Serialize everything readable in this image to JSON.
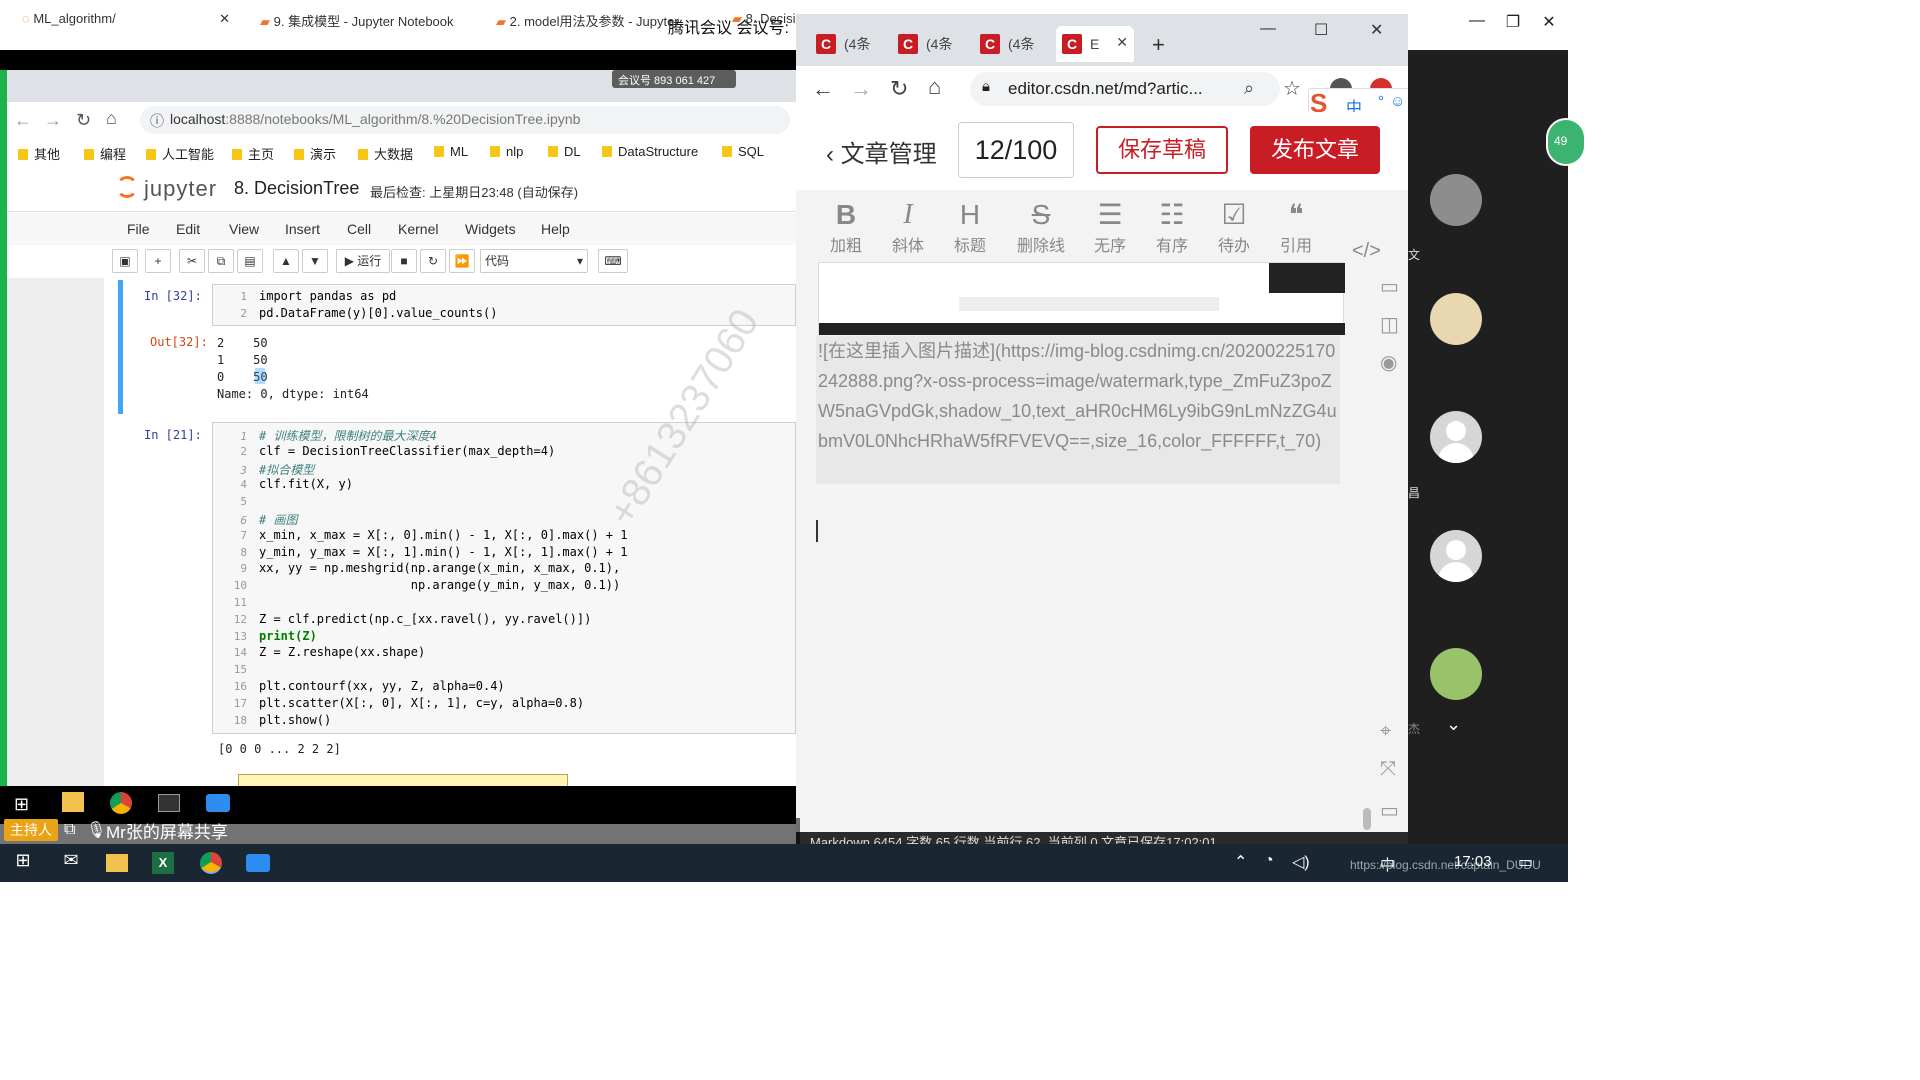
{
  "meeting": {
    "title": "腾讯会议 会议号:",
    "tag": "会议号 893 061 427",
    "participants_count": "49",
    "side_labels": [
      "文",
      "昌",
      "杰"
    ]
  },
  "jupyter_browser": {
    "tabs": [
      "ML_algorithm/",
      "9. 集成模型 - Jupyter Notebook",
      "2. model用法及参数 - Jupyter",
      "8. Decisi"
    ],
    "url_host": "localhost",
    "url_rest": ":8888/notebooks/ML_algorithm/8.%20DecisionTree.ipynb",
    "bookmarks": [
      "其他",
      "编程",
      "人工智能",
      "主页",
      "演示",
      "大数据",
      "ML",
      "nlp",
      "DL",
      "DataStructure",
      "SQL"
    ],
    "logo": "jupyter",
    "notebook_name": "8. DecisionTree",
    "checkpoint": "最后检查: 上星期日23:48  (自动保存)",
    "menus": [
      "File",
      "Edit",
      "View",
      "Insert",
      "Cell",
      "Kernel",
      "Widgets",
      "Help"
    ],
    "run_label": "运行",
    "cell_type": "代码"
  },
  "cells": {
    "c1_prompt": "In  [32]:",
    "c1_l1": "import pandas as pd",
    "c1_l2": "pd.DataFrame(y)[0].value_counts()",
    "o1_prompt": "Out[32]:",
    "o1_lines": [
      "2    50",
      "1    50",
      "0    50",
      "Name: 0, dtype: int64"
    ],
    "c2_prompt": "In  [21]:",
    "c2_lines": [
      "# 训练模型，限制树的最大深度4",
      "clf = DecisionTreeClassifier(max_depth=4)",
      "#拟合模型",
      "clf.fit(X, y)",
      "",
      "# 画图",
      "x_min, x_max = X[:, 0].min() - 1, X[:, 0].max() + 1",
      "y_min, y_max = X[:, 1].min() - 1, X[:, 1].max() + 1",
      "xx, yy = np.meshgrid(np.arange(x_min, x_max, 0.1),",
      "                     np.arange(y_min, y_max, 0.1))",
      "",
      "Z = clf.predict(np.c_[xx.ravel(), yy.ravel()])",
      "print(Z)",
      "Z = Z.reshape(xx.shape)",
      "",
      "plt.contourf(xx, yy, Z, alpha=0.4)",
      "plt.scatter(X[:, 0], X[:, 1], c=y, alpha=0.8)",
      "plt.show()"
    ],
    "o2_text": "[0 0 0 ... 2 2 2]",
    "watermark": "+8613237060"
  },
  "csdn": {
    "tabs": [
      "(4条",
      "(4条",
      "(4条",
      "E"
    ],
    "url": "editor.csdn.net/md?artic...",
    "back_label": "文章管理",
    "title_count": "12/100",
    "save_draft": "保存草稿",
    "publish": "发布文章",
    "format_tools": [
      {
        "glyph": "B",
        "label": "加粗"
      },
      {
        "glyph": "I",
        "label": "斜体"
      },
      {
        "glyph": "H",
        "label": "标题"
      },
      {
        "glyph": "S",
        "label": "删除线"
      },
      {
        "glyph": "☰",
        "label": "无序"
      },
      {
        "glyph": "☷",
        "label": "有序"
      },
      {
        "glyph": "☑",
        "label": "待办"
      },
      {
        "glyph": "❝",
        "label": "引用"
      }
    ],
    "markdown_text": "![在这里插入图片描述](https://img-blog.csdnimg.cn/20200225170242888.png?x-oss-process=image/watermark,type_ZmFuZ3poZW5naGVpdGk,shadow_10,text_aHR0cHM6Ly9ibG9nLmNzZG4ubmV0L0NhcHRhaW5fRFVEVQ==,size_16,color_FFFFFF,t_70)",
    "status": "Markdown  6454 字数  65 行数  当前行 62, 当前列 0  文章已保存17:02:01",
    "ime": "中"
  },
  "share": {
    "host_badge": "主持人",
    "presenter": "Mr张的屏幕共享"
  },
  "taskbar": {
    "time": "17:03",
    "ime": "中",
    "url_note": "https://blog.csdn.net/captain_DUDU"
  }
}
